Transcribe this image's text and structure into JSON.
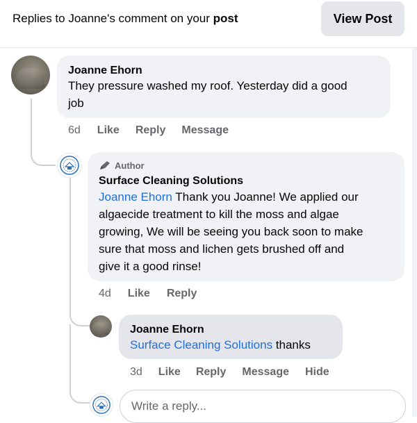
{
  "header": {
    "title_prefix": "Replies to Joanne's comment on your ",
    "title_bold": "post",
    "view_post_label": "View Post"
  },
  "comments": [
    {
      "author": "Joanne Ehorn",
      "text_line1": "They pressure washed my roof. Yesterday did a good",
      "text_line2": "job",
      "time": "6d",
      "actions": [
        "Like",
        "Reply",
        "Message"
      ]
    },
    {
      "badge": "Author",
      "author": "Surface Cleaning Solutions",
      "mention": "Joanne Ehorn",
      "lines": [
        "Thank you Joanne! We applied our",
        "algaecide treatment to kill the moss and algae",
        "growing, We will be seeing you back soon to make",
        "sure that moss and lichen gets brushed off and",
        "give it a good rinse!"
      ],
      "time": "4d",
      "actions": [
        "Like",
        "Reply"
      ]
    },
    {
      "author": "Joanne Ehorn",
      "mention": "Surface Cleaning Solutions",
      "text": " thanks",
      "time": "3d",
      "actions": [
        "Like",
        "Reply",
        "Message",
        "Hide"
      ]
    }
  ],
  "composer": {
    "placeholder": "Write a reply..."
  }
}
